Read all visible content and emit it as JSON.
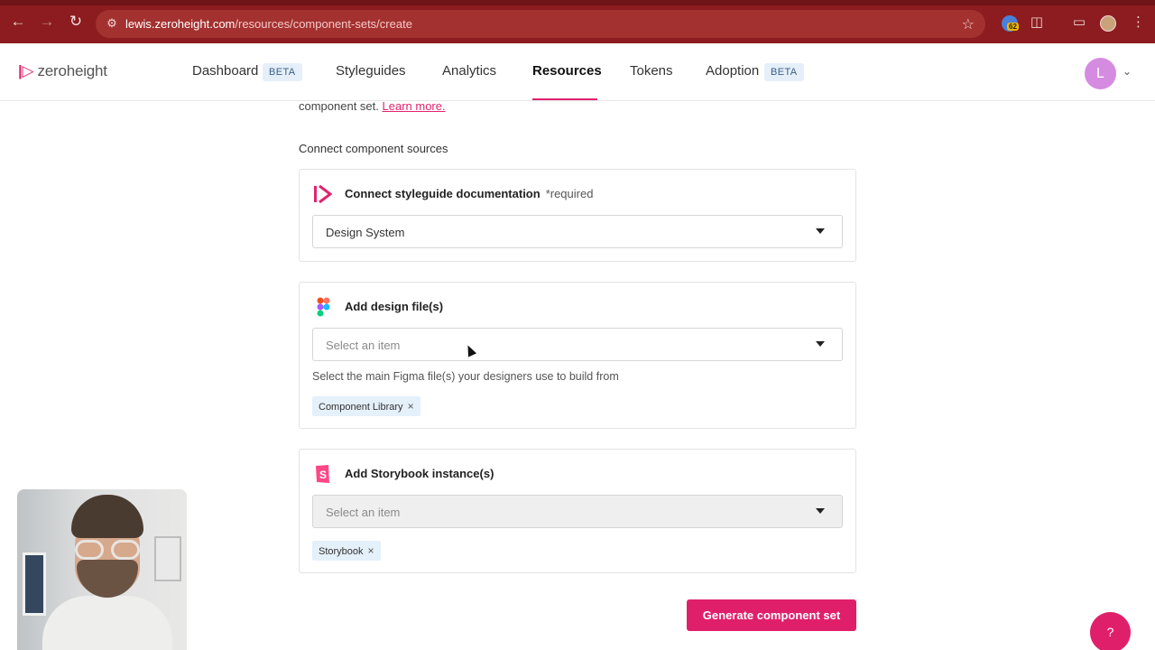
{
  "browser": {
    "url_host": "lewis.zeroheight.com",
    "url_path": "/resources/component-sets/create",
    "extension_badge": "62"
  },
  "header": {
    "logo_text": "zeroheight",
    "nav": [
      {
        "label": "Dashboard",
        "badge": "BETA"
      },
      {
        "label": "Styleguides"
      },
      {
        "label": "Analytics"
      },
      {
        "label": "Resources",
        "active": true
      },
      {
        "label": "Tokens"
      },
      {
        "label": "Adoption",
        "badge": "BETA"
      }
    ],
    "avatar_initial": "L"
  },
  "main": {
    "intro_text": "component set.",
    "intro_link": "Learn more.",
    "section_title": "Connect component sources",
    "styleguide_card": {
      "title": "Connect styleguide documentation",
      "required": "*required",
      "selected_value": "Design System"
    },
    "design_card": {
      "title": "Add design file(s)",
      "placeholder": "Select an item",
      "helper": "Select the main Figma file(s) your designers use to build from",
      "chip": "Component Library"
    },
    "storybook_card": {
      "title": "Add Storybook instance(s)",
      "placeholder": "Select an item",
      "chip": "Storybook"
    },
    "generate_button": "Generate component set",
    "help_button": "?"
  },
  "colors": {
    "accent": "#e01f6b",
    "browser_bar": "#8c1c1f",
    "chip_bg": "#e4f0fa"
  },
  "icons": {
    "styleguide": "zeroheight-logo-icon",
    "design": "figma-icon",
    "storybook": "storybook-icon"
  }
}
